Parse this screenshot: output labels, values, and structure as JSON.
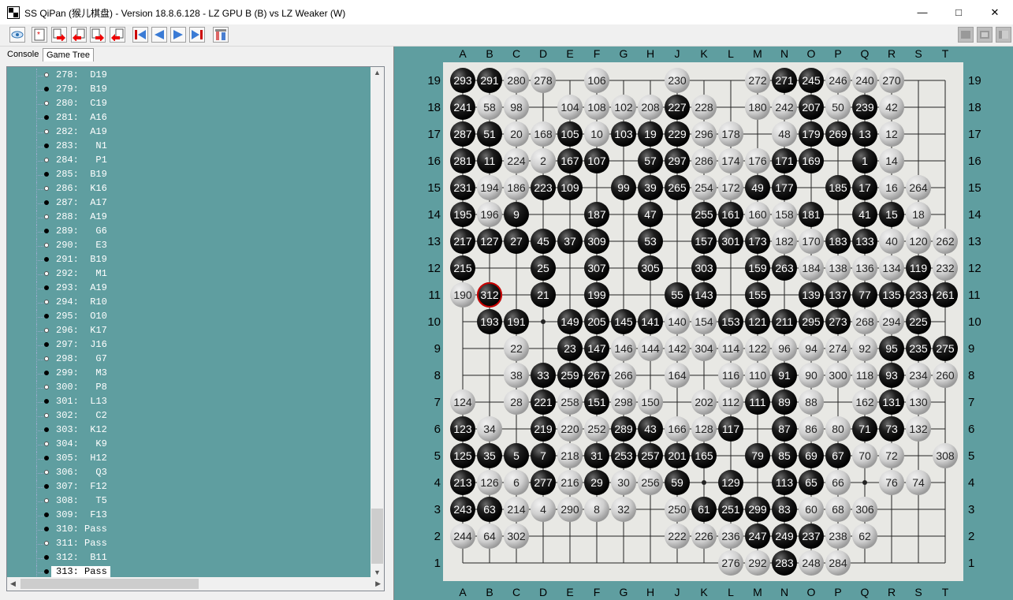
{
  "window": {
    "title": "SS QiPan (猴儿棋盘) - Version 18.8.6.128 - LZ GPU B (B) vs LZ Weaker (W)",
    "minimize_glyph": "—",
    "maximize_glyph": "□",
    "close_glyph": "✕"
  },
  "toolbar": {
    "icons": [
      "eye-icon",
      "new-game-icon",
      "add-black-icon",
      "remove-black-icon",
      "add-white-icon",
      "remove-white-icon",
      "first-move-icon",
      "previous-move-icon",
      "next-move-icon",
      "last-move-icon",
      "tools-icon",
      "layout-one-icon",
      "layout-two-icon",
      "layout-three-icon"
    ]
  },
  "tabs": [
    {
      "label": "Console"
    },
    {
      "label": "Game Tree"
    }
  ],
  "game_tree": {
    "rows": [
      {
        "label": "278:  D19",
        "color": "w"
      },
      {
        "label": "279:  B19",
        "color": "b"
      },
      {
        "label": "280:  C19",
        "color": "w"
      },
      {
        "label": "281:  A16",
        "color": "b"
      },
      {
        "label": "282:  A19",
        "color": "w"
      },
      {
        "label": "283:   N1",
        "color": "b"
      },
      {
        "label": "284:   P1",
        "color": "w"
      },
      {
        "label": "285:  B19",
        "color": "b"
      },
      {
        "label": "286:  K16",
        "color": "w"
      },
      {
        "label": "287:  A17",
        "color": "b"
      },
      {
        "label": "288:  A19",
        "color": "w"
      },
      {
        "label": "289:   G6",
        "color": "b"
      },
      {
        "label": "290:   E3",
        "color": "w"
      },
      {
        "label": "291:  B19",
        "color": "b"
      },
      {
        "label": "292:   M1",
        "color": "w"
      },
      {
        "label": "293:  A19",
        "color": "b"
      },
      {
        "label": "294:  R10",
        "color": "w"
      },
      {
        "label": "295:  O10",
        "color": "b"
      },
      {
        "label": "296:  K17",
        "color": "w"
      },
      {
        "label": "297:  J16",
        "color": "b"
      },
      {
        "label": "298:   G7",
        "color": "w"
      },
      {
        "label": "299:   M3",
        "color": "b"
      },
      {
        "label": "300:   P8",
        "color": "w"
      },
      {
        "label": "301:  L13",
        "color": "b"
      },
      {
        "label": "302:   C2",
        "color": "w"
      },
      {
        "label": "303:  K12",
        "color": "b"
      },
      {
        "label": "304:   K9",
        "color": "w"
      },
      {
        "label": "305:  H12",
        "color": "b"
      },
      {
        "label": "306:   Q3",
        "color": "w"
      },
      {
        "label": "307:  F12",
        "color": "b"
      },
      {
        "label": "308:   T5",
        "color": "w"
      },
      {
        "label": "309:  F13",
        "color": "b"
      },
      {
        "label": "310: Pass",
        "color": "b"
      },
      {
        "label": "311: Pass",
        "color": "w"
      },
      {
        "label": "312:  B11",
        "color": "b"
      },
      {
        "label": "313: Pass",
        "color": "b",
        "selected": true
      }
    ]
  },
  "board": {
    "columns": [
      "A",
      "B",
      "C",
      "D",
      "E",
      "F",
      "G",
      "H",
      "J",
      "K",
      "L",
      "M",
      "N",
      "O",
      "P",
      "Q",
      "R",
      "S",
      "T"
    ],
    "rows": [
      "19",
      "18",
      "17",
      "16",
      "15",
      "14",
      "13",
      "12",
      "11",
      "10",
      "9",
      "8",
      "7",
      "6",
      "5",
      "4",
      "3",
      "2",
      "1"
    ],
    "last_move_number": "312",
    "colors": {
      "background": "#5f9ea0",
      "board": "#e8e8e4",
      "line": "#222222",
      "last_move_ring": "#cc0000"
    },
    "stones": [
      [
        "A19",
        "b",
        "293"
      ],
      [
        "B19",
        "b",
        "291"
      ],
      [
        "C19",
        "w",
        "280"
      ],
      [
        "D19",
        "w",
        "278"
      ],
      [
        "F19",
        "w",
        "106"
      ],
      [
        "J19",
        "w",
        "230"
      ],
      [
        "M19",
        "w",
        "272"
      ],
      [
        "N19",
        "b",
        "271"
      ],
      [
        "O19",
        "b",
        "245"
      ],
      [
        "P19",
        "w",
        "246"
      ],
      [
        "Q19",
        "w",
        "240"
      ],
      [
        "R19",
        "w",
        "270"
      ],
      [
        "A18",
        "b",
        "241"
      ],
      [
        "B18",
        "w",
        "58"
      ],
      [
        "C18",
        "w",
        "98"
      ],
      [
        "E18",
        "w",
        "104"
      ],
      [
        "F18",
        "w",
        "108"
      ],
      [
        "G18",
        "w",
        "102"
      ],
      [
        "H18",
        "w",
        "208"
      ],
      [
        "J18",
        "b",
        "227"
      ],
      [
        "K18",
        "w",
        "228"
      ],
      [
        "M18",
        "w",
        "180"
      ],
      [
        "N18",
        "w",
        "242"
      ],
      [
        "O18",
        "b",
        "207"
      ],
      [
        "P18",
        "w",
        "50"
      ],
      [
        "Q18",
        "b",
        "239"
      ],
      [
        "R18",
        "w",
        "42"
      ],
      [
        "A17",
        "b",
        "287"
      ],
      [
        "B17",
        "b",
        "51"
      ],
      [
        "C17",
        "w",
        "20"
      ],
      [
        "D17",
        "w",
        "168"
      ],
      [
        "E17",
        "b",
        "105"
      ],
      [
        "F17",
        "w",
        "10"
      ],
      [
        "G17",
        "b",
        "103"
      ],
      [
        "H17",
        "b",
        "19"
      ],
      [
        "J17",
        "b",
        "229"
      ],
      [
        "K17",
        "w",
        "296"
      ],
      [
        "L17",
        "w",
        "178"
      ],
      [
        "N17",
        "w",
        "48"
      ],
      [
        "O17",
        "b",
        "179"
      ],
      [
        "P17",
        "b",
        "269"
      ],
      [
        "Q17",
        "b",
        "13"
      ],
      [
        "R17",
        "w",
        "12"
      ],
      [
        "A16",
        "b",
        "281"
      ],
      [
        "B16",
        "b",
        "11"
      ],
      [
        "C16",
        "w",
        "224"
      ],
      [
        "D16",
        "w",
        "2"
      ],
      [
        "E16",
        "b",
        "167"
      ],
      [
        "F16",
        "b",
        "107"
      ],
      [
        "H16",
        "b",
        "57"
      ],
      [
        "J16",
        "b",
        "297"
      ],
      [
        "K16",
        "w",
        "286"
      ],
      [
        "L16",
        "w",
        "174"
      ],
      [
        "M16",
        "w",
        "176"
      ],
      [
        "N16",
        "b",
        "171"
      ],
      [
        "O16",
        "b",
        "169"
      ],
      [
        "Q16",
        "b",
        "1"
      ],
      [
        "R16",
        "w",
        "14"
      ],
      [
        "A15",
        "b",
        "231"
      ],
      [
        "B15",
        "w",
        "194"
      ],
      [
        "C15",
        "w",
        "186"
      ],
      [
        "D15",
        "b",
        "223"
      ],
      [
        "E15",
        "b",
        "109"
      ],
      [
        "G15",
        "b",
        "99"
      ],
      [
        "H15",
        "b",
        "39"
      ],
      [
        "J15",
        "b",
        "265"
      ],
      [
        "K15",
        "w",
        "254"
      ],
      [
        "L15",
        "w",
        "172"
      ],
      [
        "M15",
        "b",
        "49"
      ],
      [
        "N15",
        "b",
        "177"
      ],
      [
        "P15",
        "b",
        "185"
      ],
      [
        "Q15",
        "b",
        "17"
      ],
      [
        "R15",
        "w",
        "16"
      ],
      [
        "S15",
        "w",
        "264"
      ],
      [
        "A14",
        "b",
        "195"
      ],
      [
        "B14",
        "w",
        "196"
      ],
      [
        "C14",
        "b",
        "9"
      ],
      [
        "F14",
        "b",
        "187"
      ],
      [
        "H14",
        "b",
        "47"
      ],
      [
        "K14",
        "b",
        "255"
      ],
      [
        "L14",
        "b",
        "161"
      ],
      [
        "M14",
        "w",
        "160"
      ],
      [
        "N14",
        "w",
        "158"
      ],
      [
        "O14",
        "b",
        "181"
      ],
      [
        "Q14",
        "b",
        "41"
      ],
      [
        "R14",
        "b",
        "15"
      ],
      [
        "S14",
        "w",
        "18"
      ],
      [
        "A13",
        "b",
        "217"
      ],
      [
        "B13",
        "b",
        "127"
      ],
      [
        "C13",
        "b",
        "27"
      ],
      [
        "D13",
        "b",
        "45"
      ],
      [
        "E13",
        "b",
        "37"
      ],
      [
        "F13",
        "b",
        "309"
      ],
      [
        "H13",
        "b",
        "53"
      ],
      [
        "K13",
        "b",
        "157"
      ],
      [
        "L13",
        "b",
        "301"
      ],
      [
        "M13",
        "b",
        "173"
      ],
      [
        "N13",
        "w",
        "182"
      ],
      [
        "O13",
        "w",
        "170"
      ],
      [
        "P13",
        "b",
        "183"
      ],
      [
        "Q13",
        "b",
        "133"
      ],
      [
        "R13",
        "w",
        "40"
      ],
      [
        "S13",
        "w",
        "120"
      ],
      [
        "T13",
        "w",
        "262"
      ],
      [
        "A12",
        "b",
        "215"
      ],
      [
        "D12",
        "b",
        "25"
      ],
      [
        "F12",
        "b",
        "307"
      ],
      [
        "H12",
        "b",
        "305"
      ],
      [
        "K12",
        "b",
        "303"
      ],
      [
        "M12",
        "b",
        "159"
      ],
      [
        "N12",
        "b",
        "263"
      ],
      [
        "O12",
        "w",
        "184"
      ],
      [
        "P12",
        "w",
        "138"
      ],
      [
        "Q12",
        "w",
        "136"
      ],
      [
        "R12",
        "w",
        "134"
      ],
      [
        "S12",
        "b",
        "119"
      ],
      [
        "T12",
        "w",
        "232"
      ],
      [
        "A11",
        "w",
        "190"
      ],
      [
        "B11",
        "b",
        "312"
      ],
      [
        "D11",
        "b",
        "21"
      ],
      [
        "F11",
        "b",
        "199"
      ],
      [
        "J11",
        "b",
        "55"
      ],
      [
        "K11",
        "b",
        "143"
      ],
      [
        "M11",
        "b",
        "155"
      ],
      [
        "O11",
        "b",
        "139"
      ],
      [
        "P11",
        "b",
        "137"
      ],
      [
        "Q11",
        "b",
        "77"
      ],
      [
        "R11",
        "b",
        "135"
      ],
      [
        "S11",
        "b",
        "233"
      ],
      [
        "T11",
        "b",
        "261"
      ],
      [
        "B10",
        "b",
        "193"
      ],
      [
        "C10",
        "b",
        "191"
      ],
      [
        "E10",
        "b",
        "149"
      ],
      [
        "F10",
        "b",
        "205"
      ],
      [
        "G10",
        "b",
        "145"
      ],
      [
        "H10",
        "b",
        "141"
      ],
      [
        "J10",
        "w",
        "140"
      ],
      [
        "K10",
        "w",
        "154"
      ],
      [
        "L10",
        "b",
        "153"
      ],
      [
        "M10",
        "b",
        "121"
      ],
      [
        "N10",
        "b",
        "211"
      ],
      [
        "O10",
        "b",
        "295"
      ],
      [
        "P10",
        "b",
        "273"
      ],
      [
        "Q10",
        "w",
        "268"
      ],
      [
        "R10",
        "w",
        "294"
      ],
      [
        "S10",
        "b",
        "225"
      ],
      [
        "C9",
        "w",
        "22"
      ],
      [
        "E9",
        "b",
        "23"
      ],
      [
        "F9",
        "b",
        "147"
      ],
      [
        "G9",
        "w",
        "146"
      ],
      [
        "H9",
        "w",
        "144"
      ],
      [
        "J9",
        "w",
        "142"
      ],
      [
        "K9",
        "w",
        "304"
      ],
      [
        "L9",
        "w",
        "114"
      ],
      [
        "M9",
        "w",
        "122"
      ],
      [
        "N9",
        "w",
        "96"
      ],
      [
        "O9",
        "w",
        "94"
      ],
      [
        "P9",
        "w",
        "274"
      ],
      [
        "Q9",
        "w",
        "92"
      ],
      [
        "R9",
        "b",
        "95"
      ],
      [
        "S9",
        "b",
        "235"
      ],
      [
        "T9",
        "b",
        "275"
      ],
      [
        "C8",
        "w",
        "38"
      ],
      [
        "D8",
        "b",
        "33"
      ],
      [
        "E8",
        "b",
        "259"
      ],
      [
        "F8",
        "b",
        "267"
      ],
      [
        "G8",
        "w",
        "266"
      ],
      [
        "J8",
        "w",
        "164"
      ],
      [
        "L8",
        "w",
        "116"
      ],
      [
        "M8",
        "w",
        "110"
      ],
      [
        "N8",
        "b",
        "91"
      ],
      [
        "O8",
        "w",
        "90"
      ],
      [
        "P8",
        "w",
        "300"
      ],
      [
        "Q8",
        "w",
        "118"
      ],
      [
        "R8",
        "b",
        "93"
      ],
      [
        "S8",
        "w",
        "234"
      ],
      [
        "T8",
        "w",
        "260"
      ],
      [
        "A7",
        "w",
        "124"
      ],
      [
        "C7",
        "w",
        "28"
      ],
      [
        "D7",
        "b",
        "221"
      ],
      [
        "E7",
        "w",
        "258"
      ],
      [
        "F7",
        "b",
        "151"
      ],
      [
        "G7",
        "w",
        "298"
      ],
      [
        "H7",
        "w",
        "150"
      ],
      [
        "K7",
        "w",
        "202"
      ],
      [
        "L7",
        "w",
        "112"
      ],
      [
        "M7",
        "b",
        "111"
      ],
      [
        "N7",
        "b",
        "89"
      ],
      [
        "O7",
        "w",
        "88"
      ],
      [
        "Q7",
        "w",
        "162"
      ],
      [
        "R7",
        "b",
        "131"
      ],
      [
        "S7",
        "w",
        "130"
      ],
      [
        "A6",
        "b",
        "123"
      ],
      [
        "B6",
        "w",
        "34"
      ],
      [
        "D6",
        "b",
        "219"
      ],
      [
        "E6",
        "w",
        "220"
      ],
      [
        "F6",
        "w",
        "252"
      ],
      [
        "G6",
        "b",
        "289"
      ],
      [
        "H6",
        "b",
        "43"
      ],
      [
        "J6",
        "w",
        "166"
      ],
      [
        "K6",
        "w",
        "128"
      ],
      [
        "L6",
        "b",
        "117"
      ],
      [
        "N6",
        "b",
        "87"
      ],
      [
        "O6",
        "w",
        "86"
      ],
      [
        "P6",
        "w",
        "80"
      ],
      [
        "Q6",
        "b",
        "71"
      ],
      [
        "R6",
        "b",
        "73"
      ],
      [
        "S6",
        "w",
        "132"
      ],
      [
        "A5",
        "b",
        "125"
      ],
      [
        "B5",
        "b",
        "35"
      ],
      [
        "C5",
        "b",
        "5"
      ],
      [
        "D5",
        "b",
        "7"
      ],
      [
        "E5",
        "w",
        "218"
      ],
      [
        "F5",
        "b",
        "31"
      ],
      [
        "G5",
        "b",
        "253"
      ],
      [
        "H5",
        "b",
        "257"
      ],
      [
        "J5",
        "b",
        "201"
      ],
      [
        "K5",
        "b",
        "165"
      ],
      [
        "M5",
        "b",
        "79"
      ],
      [
        "N5",
        "b",
        "85"
      ],
      [
        "O5",
        "b",
        "69"
      ],
      [
        "P5",
        "b",
        "67"
      ],
      [
        "Q5",
        "w",
        "70"
      ],
      [
        "R5",
        "w",
        "72"
      ],
      [
        "T5",
        "w",
        "308"
      ],
      [
        "A4",
        "b",
        "213"
      ],
      [
        "B4",
        "w",
        "126"
      ],
      [
        "C4",
        "w",
        "6"
      ],
      [
        "D4",
        "b",
        "277"
      ],
      [
        "E4",
        "w",
        "216"
      ],
      [
        "F4",
        "b",
        "29"
      ],
      [
        "G4",
        "w",
        "30"
      ],
      [
        "H4",
        "w",
        "256"
      ],
      [
        "J4",
        "b",
        "59"
      ],
      [
        "L4",
        "b",
        "129"
      ],
      [
        "N4",
        "b",
        "113"
      ],
      [
        "O4",
        "b",
        "65"
      ],
      [
        "P4",
        "w",
        "66"
      ],
      [
        "R4",
        "w",
        "76"
      ],
      [
        "S4",
        "w",
        "74"
      ],
      [
        "A3",
        "b",
        "243"
      ],
      [
        "B3",
        "b",
        "63"
      ],
      [
        "C3",
        "w",
        "214"
      ],
      [
        "D3",
        "w",
        "4"
      ],
      [
        "E3",
        "w",
        "290"
      ],
      [
        "F3",
        "w",
        "8"
      ],
      [
        "G3",
        "w",
        "32"
      ],
      [
        "J3",
        "w",
        "250"
      ],
      [
        "K3",
        "b",
        "61"
      ],
      [
        "L3",
        "b",
        "251"
      ],
      [
        "M3",
        "b",
        "299"
      ],
      [
        "N3",
        "b",
        "83"
      ],
      [
        "O3",
        "w",
        "60"
      ],
      [
        "P3",
        "w",
        "68"
      ],
      [
        "Q3",
        "w",
        "306"
      ],
      [
        "A2",
        "w",
        "244"
      ],
      [
        "B2",
        "w",
        "64"
      ],
      [
        "C2",
        "w",
        "302"
      ],
      [
        "J2",
        "w",
        "222"
      ],
      [
        "K2",
        "w",
        "226"
      ],
      [
        "L2",
        "w",
        "236"
      ],
      [
        "M2",
        "b",
        "247"
      ],
      [
        "N2",
        "b",
        "249"
      ],
      [
        "O2",
        "b",
        "237"
      ],
      [
        "P2",
        "w",
        "238"
      ],
      [
        "Q2",
        "w",
        "62"
      ],
      [
        "L1",
        "w",
        "276"
      ],
      [
        "M1",
        "w",
        "292"
      ],
      [
        "N1",
        "b",
        "283"
      ],
      [
        "O1",
        "w",
        "248"
      ],
      [
        "P1",
        "w",
        "284"
      ]
    ]
  }
}
